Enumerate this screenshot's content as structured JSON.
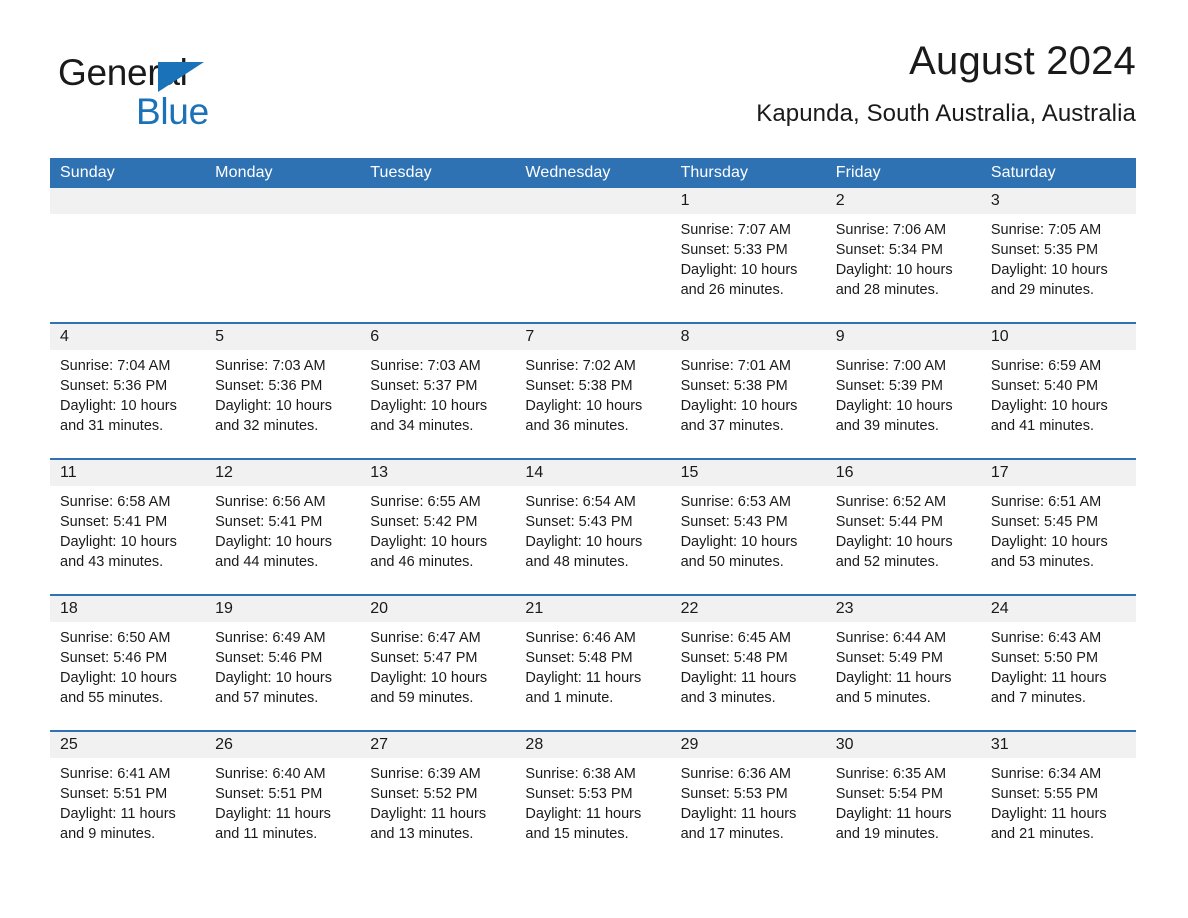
{
  "brand": {
    "word_one": "General",
    "word_two": "Blue",
    "triangle_color": "#1a72b8",
    "blue_text_color": "#1a72b8"
  },
  "header": {
    "title": "August 2024",
    "subtitle": "Kapunda, South Australia, Australia"
  },
  "theme": {
    "header_blue": "#2f72b4",
    "row_divider_blue": "#2f72b4",
    "daynum_band": "#f1f1f1",
    "text": "#1a1a1a",
    "page_background": "#ffffff"
  },
  "calendar": {
    "weekday_headers": [
      "Sunday",
      "Monday",
      "Tuesday",
      "Wednesday",
      "Thursday",
      "Friday",
      "Saturday"
    ],
    "weeks": [
      [
        {
          "day": "",
          "sunrise": "",
          "sunset": "",
          "daylight": ""
        },
        {
          "day": "",
          "sunrise": "",
          "sunset": "",
          "daylight": ""
        },
        {
          "day": "",
          "sunrise": "",
          "sunset": "",
          "daylight": ""
        },
        {
          "day": "",
          "sunrise": "",
          "sunset": "",
          "daylight": ""
        },
        {
          "day": "1",
          "sunrise": "Sunrise: 7:07 AM",
          "sunset": "Sunset: 5:33 PM",
          "daylight": "Daylight: 10 hours and 26 minutes."
        },
        {
          "day": "2",
          "sunrise": "Sunrise: 7:06 AM",
          "sunset": "Sunset: 5:34 PM",
          "daylight": "Daylight: 10 hours and 28 minutes."
        },
        {
          "day": "3",
          "sunrise": "Sunrise: 7:05 AM",
          "sunset": "Sunset: 5:35 PM",
          "daylight": "Daylight: 10 hours and 29 minutes."
        }
      ],
      [
        {
          "day": "4",
          "sunrise": "Sunrise: 7:04 AM",
          "sunset": "Sunset: 5:36 PM",
          "daylight": "Daylight: 10 hours and 31 minutes."
        },
        {
          "day": "5",
          "sunrise": "Sunrise: 7:03 AM",
          "sunset": "Sunset: 5:36 PM",
          "daylight": "Daylight: 10 hours and 32 minutes."
        },
        {
          "day": "6",
          "sunrise": "Sunrise: 7:03 AM",
          "sunset": "Sunset: 5:37 PM",
          "daylight": "Daylight: 10 hours and 34 minutes."
        },
        {
          "day": "7",
          "sunrise": "Sunrise: 7:02 AM",
          "sunset": "Sunset: 5:38 PM",
          "daylight": "Daylight: 10 hours and 36 minutes."
        },
        {
          "day": "8",
          "sunrise": "Sunrise: 7:01 AM",
          "sunset": "Sunset: 5:38 PM",
          "daylight": "Daylight: 10 hours and 37 minutes."
        },
        {
          "day": "9",
          "sunrise": "Sunrise: 7:00 AM",
          "sunset": "Sunset: 5:39 PM",
          "daylight": "Daylight: 10 hours and 39 minutes."
        },
        {
          "day": "10",
          "sunrise": "Sunrise: 6:59 AM",
          "sunset": "Sunset: 5:40 PM",
          "daylight": "Daylight: 10 hours and 41 minutes."
        }
      ],
      [
        {
          "day": "11",
          "sunrise": "Sunrise: 6:58 AM",
          "sunset": "Sunset: 5:41 PM",
          "daylight": "Daylight: 10 hours and 43 minutes."
        },
        {
          "day": "12",
          "sunrise": "Sunrise: 6:56 AM",
          "sunset": "Sunset: 5:41 PM",
          "daylight": "Daylight: 10 hours and 44 minutes."
        },
        {
          "day": "13",
          "sunrise": "Sunrise: 6:55 AM",
          "sunset": "Sunset: 5:42 PM",
          "daylight": "Daylight: 10 hours and 46 minutes."
        },
        {
          "day": "14",
          "sunrise": "Sunrise: 6:54 AM",
          "sunset": "Sunset: 5:43 PM",
          "daylight": "Daylight: 10 hours and 48 minutes."
        },
        {
          "day": "15",
          "sunrise": "Sunrise: 6:53 AM",
          "sunset": "Sunset: 5:43 PM",
          "daylight": "Daylight: 10 hours and 50 minutes."
        },
        {
          "day": "16",
          "sunrise": "Sunrise: 6:52 AM",
          "sunset": "Sunset: 5:44 PM",
          "daylight": "Daylight: 10 hours and 52 minutes."
        },
        {
          "day": "17",
          "sunrise": "Sunrise: 6:51 AM",
          "sunset": "Sunset: 5:45 PM",
          "daylight": "Daylight: 10 hours and 53 minutes."
        }
      ],
      [
        {
          "day": "18",
          "sunrise": "Sunrise: 6:50 AM",
          "sunset": "Sunset: 5:46 PM",
          "daylight": "Daylight: 10 hours and 55 minutes."
        },
        {
          "day": "19",
          "sunrise": "Sunrise: 6:49 AM",
          "sunset": "Sunset: 5:46 PM",
          "daylight": "Daylight: 10 hours and 57 minutes."
        },
        {
          "day": "20",
          "sunrise": "Sunrise: 6:47 AM",
          "sunset": "Sunset: 5:47 PM",
          "daylight": "Daylight: 10 hours and 59 minutes."
        },
        {
          "day": "21",
          "sunrise": "Sunrise: 6:46 AM",
          "sunset": "Sunset: 5:48 PM",
          "daylight": "Daylight: 11 hours and 1 minute."
        },
        {
          "day": "22",
          "sunrise": "Sunrise: 6:45 AM",
          "sunset": "Sunset: 5:48 PM",
          "daylight": "Daylight: 11 hours and 3 minutes."
        },
        {
          "day": "23",
          "sunrise": "Sunrise: 6:44 AM",
          "sunset": "Sunset: 5:49 PM",
          "daylight": "Daylight: 11 hours and 5 minutes."
        },
        {
          "day": "24",
          "sunrise": "Sunrise: 6:43 AM",
          "sunset": "Sunset: 5:50 PM",
          "daylight": "Daylight: 11 hours and 7 minutes."
        }
      ],
      [
        {
          "day": "25",
          "sunrise": "Sunrise: 6:41 AM",
          "sunset": "Sunset: 5:51 PM",
          "daylight": "Daylight: 11 hours and 9 minutes."
        },
        {
          "day": "26",
          "sunrise": "Sunrise: 6:40 AM",
          "sunset": "Sunset: 5:51 PM",
          "daylight": "Daylight: 11 hours and 11 minutes."
        },
        {
          "day": "27",
          "sunrise": "Sunrise: 6:39 AM",
          "sunset": "Sunset: 5:52 PM",
          "daylight": "Daylight: 11 hours and 13 minutes."
        },
        {
          "day": "28",
          "sunrise": "Sunrise: 6:38 AM",
          "sunset": "Sunset: 5:53 PM",
          "daylight": "Daylight: 11 hours and 15 minutes."
        },
        {
          "day": "29",
          "sunrise": "Sunrise: 6:36 AM",
          "sunset": "Sunset: 5:53 PM",
          "daylight": "Daylight: 11 hours and 17 minutes."
        },
        {
          "day": "30",
          "sunrise": "Sunrise: 6:35 AM",
          "sunset": "Sunset: 5:54 PM",
          "daylight": "Daylight: 11 hours and 19 minutes."
        },
        {
          "day": "31",
          "sunrise": "Sunrise: 6:34 AM",
          "sunset": "Sunset: 5:55 PM",
          "daylight": "Daylight: 11 hours and 21 minutes."
        }
      ]
    ]
  }
}
